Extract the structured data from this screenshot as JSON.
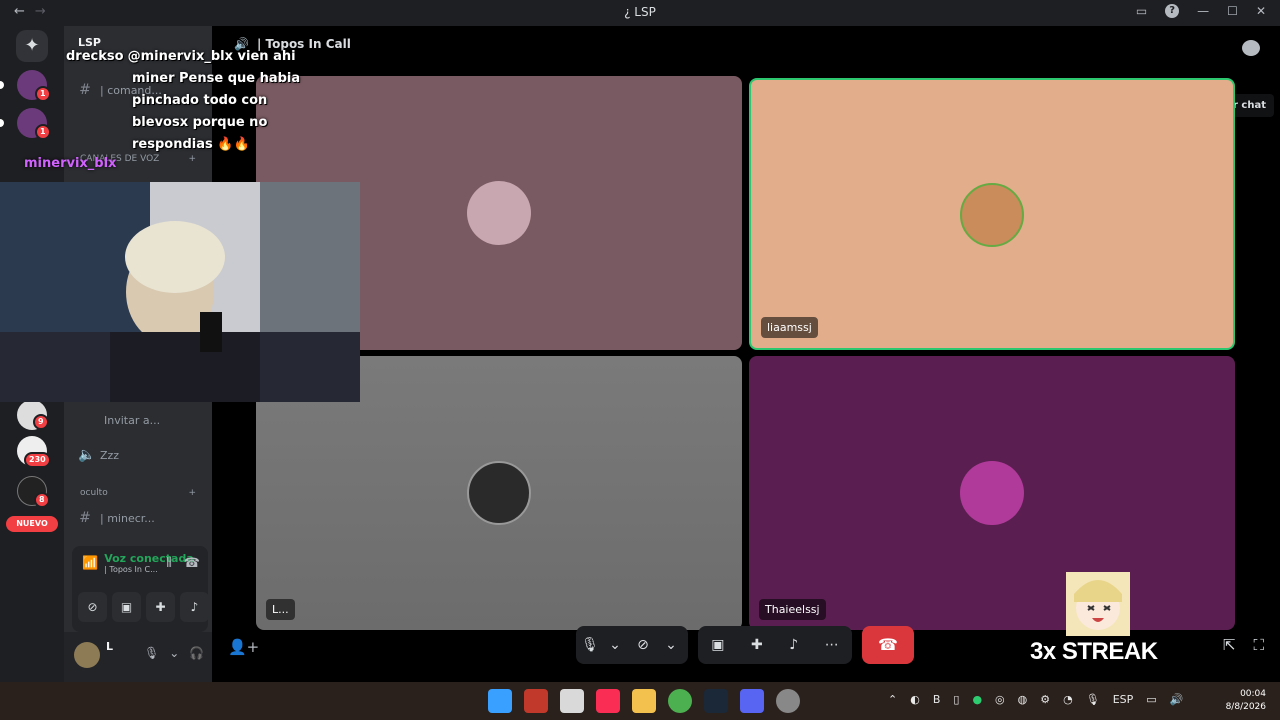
{
  "window": {
    "title": "¿ LSP",
    "back": "←",
    "forward": "→"
  },
  "sidebar": {
    "server_name": "LSP",
    "channel_command": "| comand...",
    "category_voice": "CANALES DE VOZ",
    "invite": "Invitar a...",
    "voice_channel_zzz": "Zzz",
    "category_oculto": "oculto",
    "channel_minecraft": "| minecr..."
  },
  "rail": {
    "badges": [
      "1",
      "1",
      "9",
      "230",
      "8"
    ],
    "nuevo": "NUEVO"
  },
  "voice_panel": {
    "status": "Voz conectada",
    "channel": "| Topos In C..."
  },
  "user": {
    "name": "L"
  },
  "call": {
    "channel_title": "| Topos In Call",
    "tooltip": "Mostrar chat",
    "tiles": [
      {
        "label": ""
      },
      {
        "label": "liaamssj"
      },
      {
        "label": "L..."
      },
      {
        "label": "Thaieelssj"
      }
    ]
  },
  "overlay": {
    "chat_user": "dreckso",
    "chat_message": "@minervix_blx vien ahi miner Pense que habia pinchado todo con blevosx porque no respondias 🔥🔥",
    "mention_user": "minervix_blx",
    "streak": "3x STREAK"
  },
  "taskbar": {
    "lang": "ESP",
    "time": "00:04",
    "date": "8/8/2026"
  },
  "colors": {
    "tile1": "#7a5a62",
    "tile2": "#e2ad8a",
    "tile3": "#7a7a7a",
    "tile4": "#5a1f50",
    "leave": "#da373c",
    "voice_connected": "#23a55a"
  }
}
